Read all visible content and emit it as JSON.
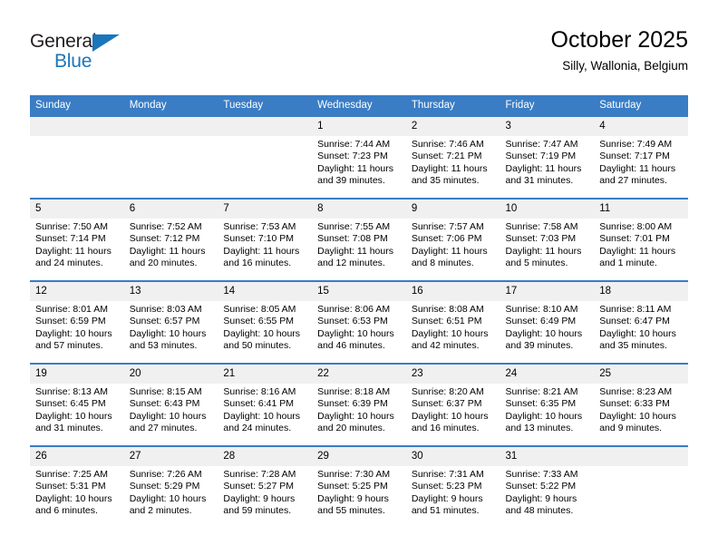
{
  "brand": {
    "name_primary": "General",
    "name_secondary": "Blue",
    "triangle_color": "#1b75bb"
  },
  "header": {
    "title": "October 2025",
    "subtitle": "Silly, Wallonia, Belgium"
  },
  "theme": {
    "header_bar_color": "#3a7dc5",
    "daynum_bg": "#f0f0f0",
    "text_color": "#000000"
  },
  "weekday_headers": [
    "Sunday",
    "Monday",
    "Tuesday",
    "Wednesday",
    "Thursday",
    "Friday",
    "Saturday"
  ],
  "weeks": [
    [
      {
        "day": "",
        "sunrise": "",
        "sunset": "",
        "daylight_line1": "",
        "daylight_line2": ""
      },
      {
        "day": "",
        "sunrise": "",
        "sunset": "",
        "daylight_line1": "",
        "daylight_line2": ""
      },
      {
        "day": "",
        "sunrise": "",
        "sunset": "",
        "daylight_line1": "",
        "daylight_line2": ""
      },
      {
        "day": "1",
        "sunrise": "Sunrise: 7:44 AM",
        "sunset": "Sunset: 7:23 PM",
        "daylight_line1": "Daylight: 11 hours",
        "daylight_line2": "and 39 minutes."
      },
      {
        "day": "2",
        "sunrise": "Sunrise: 7:46 AM",
        "sunset": "Sunset: 7:21 PM",
        "daylight_line1": "Daylight: 11 hours",
        "daylight_line2": "and 35 minutes."
      },
      {
        "day": "3",
        "sunrise": "Sunrise: 7:47 AM",
        "sunset": "Sunset: 7:19 PM",
        "daylight_line1": "Daylight: 11 hours",
        "daylight_line2": "and 31 minutes."
      },
      {
        "day": "4",
        "sunrise": "Sunrise: 7:49 AM",
        "sunset": "Sunset: 7:17 PM",
        "daylight_line1": "Daylight: 11 hours",
        "daylight_line2": "and 27 minutes."
      }
    ],
    [
      {
        "day": "5",
        "sunrise": "Sunrise: 7:50 AM",
        "sunset": "Sunset: 7:14 PM",
        "daylight_line1": "Daylight: 11 hours",
        "daylight_line2": "and 24 minutes."
      },
      {
        "day": "6",
        "sunrise": "Sunrise: 7:52 AM",
        "sunset": "Sunset: 7:12 PM",
        "daylight_line1": "Daylight: 11 hours",
        "daylight_line2": "and 20 minutes."
      },
      {
        "day": "7",
        "sunrise": "Sunrise: 7:53 AM",
        "sunset": "Sunset: 7:10 PM",
        "daylight_line1": "Daylight: 11 hours",
        "daylight_line2": "and 16 minutes."
      },
      {
        "day": "8",
        "sunrise": "Sunrise: 7:55 AM",
        "sunset": "Sunset: 7:08 PM",
        "daylight_line1": "Daylight: 11 hours",
        "daylight_line2": "and 12 minutes."
      },
      {
        "day": "9",
        "sunrise": "Sunrise: 7:57 AM",
        "sunset": "Sunset: 7:06 PM",
        "daylight_line1": "Daylight: 11 hours",
        "daylight_line2": "and 8 minutes."
      },
      {
        "day": "10",
        "sunrise": "Sunrise: 7:58 AM",
        "sunset": "Sunset: 7:03 PM",
        "daylight_line1": "Daylight: 11 hours",
        "daylight_line2": "and 5 minutes."
      },
      {
        "day": "11",
        "sunrise": "Sunrise: 8:00 AM",
        "sunset": "Sunset: 7:01 PM",
        "daylight_line1": "Daylight: 11 hours",
        "daylight_line2": "and 1 minute."
      }
    ],
    [
      {
        "day": "12",
        "sunrise": "Sunrise: 8:01 AM",
        "sunset": "Sunset: 6:59 PM",
        "daylight_line1": "Daylight: 10 hours",
        "daylight_line2": "and 57 minutes."
      },
      {
        "day": "13",
        "sunrise": "Sunrise: 8:03 AM",
        "sunset": "Sunset: 6:57 PM",
        "daylight_line1": "Daylight: 10 hours",
        "daylight_line2": "and 53 minutes."
      },
      {
        "day": "14",
        "sunrise": "Sunrise: 8:05 AM",
        "sunset": "Sunset: 6:55 PM",
        "daylight_line1": "Daylight: 10 hours",
        "daylight_line2": "and 50 minutes."
      },
      {
        "day": "15",
        "sunrise": "Sunrise: 8:06 AM",
        "sunset": "Sunset: 6:53 PM",
        "daylight_line1": "Daylight: 10 hours",
        "daylight_line2": "and 46 minutes."
      },
      {
        "day": "16",
        "sunrise": "Sunrise: 8:08 AM",
        "sunset": "Sunset: 6:51 PM",
        "daylight_line1": "Daylight: 10 hours",
        "daylight_line2": "and 42 minutes."
      },
      {
        "day": "17",
        "sunrise": "Sunrise: 8:10 AM",
        "sunset": "Sunset: 6:49 PM",
        "daylight_line1": "Daylight: 10 hours",
        "daylight_line2": "and 39 minutes."
      },
      {
        "day": "18",
        "sunrise": "Sunrise: 8:11 AM",
        "sunset": "Sunset: 6:47 PM",
        "daylight_line1": "Daylight: 10 hours",
        "daylight_line2": "and 35 minutes."
      }
    ],
    [
      {
        "day": "19",
        "sunrise": "Sunrise: 8:13 AM",
        "sunset": "Sunset: 6:45 PM",
        "daylight_line1": "Daylight: 10 hours",
        "daylight_line2": "and 31 minutes."
      },
      {
        "day": "20",
        "sunrise": "Sunrise: 8:15 AM",
        "sunset": "Sunset: 6:43 PM",
        "daylight_line1": "Daylight: 10 hours",
        "daylight_line2": "and 27 minutes."
      },
      {
        "day": "21",
        "sunrise": "Sunrise: 8:16 AM",
        "sunset": "Sunset: 6:41 PM",
        "daylight_line1": "Daylight: 10 hours",
        "daylight_line2": "and 24 minutes."
      },
      {
        "day": "22",
        "sunrise": "Sunrise: 8:18 AM",
        "sunset": "Sunset: 6:39 PM",
        "daylight_line1": "Daylight: 10 hours",
        "daylight_line2": "and 20 minutes."
      },
      {
        "day": "23",
        "sunrise": "Sunrise: 8:20 AM",
        "sunset": "Sunset: 6:37 PM",
        "daylight_line1": "Daylight: 10 hours",
        "daylight_line2": "and 16 minutes."
      },
      {
        "day": "24",
        "sunrise": "Sunrise: 8:21 AM",
        "sunset": "Sunset: 6:35 PM",
        "daylight_line1": "Daylight: 10 hours",
        "daylight_line2": "and 13 minutes."
      },
      {
        "day": "25",
        "sunrise": "Sunrise: 8:23 AM",
        "sunset": "Sunset: 6:33 PM",
        "daylight_line1": "Daylight: 10 hours",
        "daylight_line2": "and 9 minutes."
      }
    ],
    [
      {
        "day": "26",
        "sunrise": "Sunrise: 7:25 AM",
        "sunset": "Sunset: 5:31 PM",
        "daylight_line1": "Daylight: 10 hours",
        "daylight_line2": "and 6 minutes."
      },
      {
        "day": "27",
        "sunrise": "Sunrise: 7:26 AM",
        "sunset": "Sunset: 5:29 PM",
        "daylight_line1": "Daylight: 10 hours",
        "daylight_line2": "and 2 minutes."
      },
      {
        "day": "28",
        "sunrise": "Sunrise: 7:28 AM",
        "sunset": "Sunset: 5:27 PM",
        "daylight_line1": "Daylight: 9 hours",
        "daylight_line2": "and 59 minutes."
      },
      {
        "day": "29",
        "sunrise": "Sunrise: 7:30 AM",
        "sunset": "Sunset: 5:25 PM",
        "daylight_line1": "Daylight: 9 hours",
        "daylight_line2": "and 55 minutes."
      },
      {
        "day": "30",
        "sunrise": "Sunrise: 7:31 AM",
        "sunset": "Sunset: 5:23 PM",
        "daylight_line1": "Daylight: 9 hours",
        "daylight_line2": "and 51 minutes."
      },
      {
        "day": "31",
        "sunrise": "Sunrise: 7:33 AM",
        "sunset": "Sunset: 5:22 PM",
        "daylight_line1": "Daylight: 9 hours",
        "daylight_line2": "and 48 minutes."
      },
      {
        "day": "",
        "sunrise": "",
        "sunset": "",
        "daylight_line1": "",
        "daylight_line2": ""
      }
    ]
  ]
}
